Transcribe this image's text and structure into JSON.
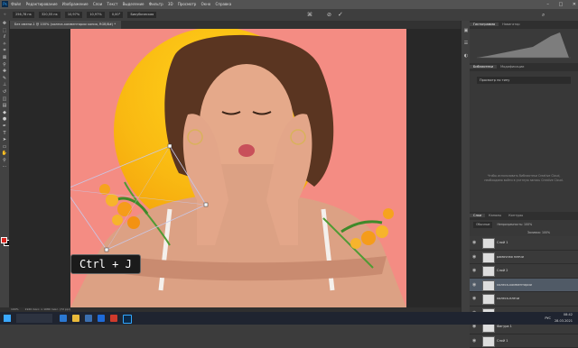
{
  "menubar": {
    "items": [
      "Файл",
      "Редактирование",
      "Изображение",
      "Слои",
      "Текст",
      "Выделение",
      "Фильтр",
      "3D",
      "Просмотр",
      "Окно",
      "Справка"
    ]
  },
  "optionsbar": {
    "x": "256,78 пк",
    "y": "320,55 пк",
    "w": "10,97%",
    "h": "10,97%",
    "angle": "0,00°",
    "interp": "Бикубическая"
  },
  "document": {
    "tab_title": "Без имени-1 @ 100% (колеса-комментарии копия, RGB/8#) *",
    "zoom": "100%",
    "size": "1920 пикс. x 1080 пикс. (72 ppi)"
  },
  "shortcut": {
    "text": "Ctrl + J"
  },
  "panels": {
    "top_tabs": [
      "Гистограмма",
      "Навигатор"
    ],
    "mid_tabs": [
      "Библиотеки",
      "Модификации"
    ],
    "lib_select": "Просмотр по типу",
    "lib_message": "Чтобы использовать библиотеки Creative Cloud, необходимо войти в учетную запись Creative Cloud.",
    "layers_tabs": [
      "Слои",
      "Каналы",
      "Контуры"
    ],
    "blend": "Обычные",
    "opacity": "Непрозрачность: 100%",
    "fill": "Заливка: 100%",
    "layers": [
      {
        "name": "Слой 1",
        "selected": false
      },
      {
        "name": "рамочная плечи",
        "selected": false
      },
      {
        "name": "Слой 2",
        "selected": false
      },
      {
        "name": "колеса-комментарии",
        "selected": true
      },
      {
        "name": "колеса-плечи",
        "selected": false
      },
      {
        "name": "рамочка",
        "selected": false
      },
      {
        "name": "Фигура 1",
        "selected": false
      },
      {
        "name": "Слой 1",
        "selected": false
      }
    ]
  },
  "taskbar": {
    "lang": "РУС",
    "time": "08:42",
    "date": "28.03.2021"
  },
  "colors": {
    "foreground": "#d6231c",
    "background": "#111111",
    "canvas_bg": "#f48c83",
    "sun": "#f9b912"
  }
}
